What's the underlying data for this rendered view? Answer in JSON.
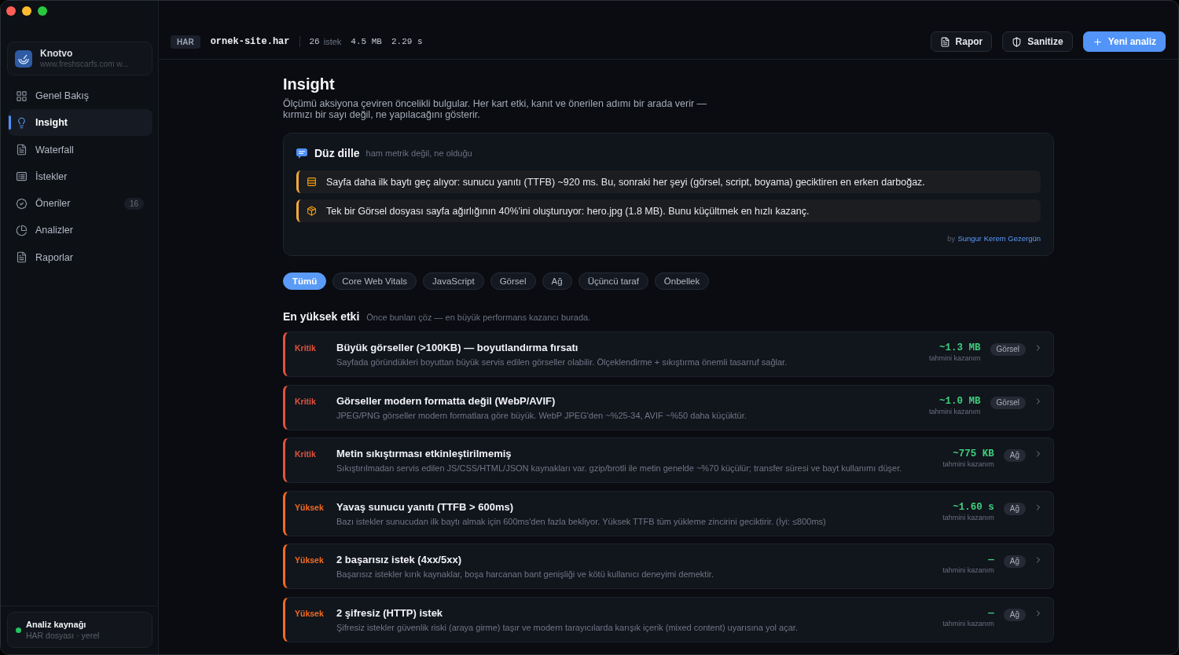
{
  "sidebar": {
    "workspace": {
      "name": "Knotvo",
      "url": "www.freshscarfs.com w..."
    },
    "items": [
      {
        "label": "Genel Bakış",
        "selected": false
      },
      {
        "label": "Insight",
        "selected": true
      },
      {
        "label": "Waterfall",
        "selected": false
      },
      {
        "label": "İstekler",
        "selected": false
      },
      {
        "label": "Öneriler",
        "selected": false,
        "badge": "16"
      },
      {
        "label": "Analizler",
        "selected": false
      },
      {
        "label": "Raporlar",
        "selected": false
      }
    ],
    "source": {
      "title": "Analiz kaynağı",
      "subtitle": "HAR dosyası · yerel",
      "active": true
    }
  },
  "topbar": {
    "format": "HAR",
    "file": "ornek-site.har",
    "request_count": "26",
    "request_label": "istek",
    "size": "4.5 MB",
    "duration": "2.29 s",
    "actions": [
      {
        "label": "Rapor",
        "kind": "secondary"
      },
      {
        "label": "Sanitize",
        "kind": "secondary"
      },
      {
        "label": "Yeni analiz",
        "kind": "primary"
      }
    ]
  },
  "page": {
    "title": "Insight",
    "subtitle": "Ölçümü aksiyona çeviren öncelikli bulgular. Her kart etki, kanıt ve önerilen adımı bir arada verir —\nkırmızı bir sayı değil, ne yapılacağını gösterir."
  },
  "plain_language": {
    "title": "Düz dille",
    "subtitle": "ham metrik değil, ne olduğu",
    "items": [
      "Sayfa daha ilk baytı geç alıyor: sunucu yanıtı (TTFB) ~920 ms. Bu, sonraki her şeyi (görsel, script, boyama) geciktiren en erken darboğaz.",
      "Tek bir Görsel dosyası sayfa ağırlığının 40%'ini oluşturuyor: hero.jpg (1.8 MB). Bunu küçültmek en hızlı kazanç."
    ],
    "credit": {
      "prefix": "by",
      "author": "Sungur Kerem Gezergün"
    }
  },
  "filters": [
    {
      "label": "Tümü",
      "selected": true
    },
    {
      "label": "Core Web Vitals",
      "selected": false
    },
    {
      "label": "JavaScript",
      "selected": false
    },
    {
      "label": "Görsel",
      "selected": false
    },
    {
      "label": "Ağ",
      "selected": false
    },
    {
      "label": "Üçüncü taraf",
      "selected": false
    },
    {
      "label": "Önbellek",
      "selected": false
    }
  ],
  "section": {
    "title": "En yüksek etki",
    "subtitle": "Önce bunları çöz — en büyük performans kazancı burada."
  },
  "findings": [
    {
      "severity": "Kritik",
      "color": "#e5533d",
      "title": "Büyük görseller (>100KB) — boyutlandırma fırsatı",
      "description": "Sayfada göründükleri boyuttan büyük servis edilen görseller olabilir. Ölçeklendirme + sıkıştırma önemli tasarruf sağlar.",
      "gain": "~1.3 MB",
      "gain_label": "tahmini kazanım",
      "tag": "Görsel"
    },
    {
      "severity": "Kritik",
      "color": "#e5533d",
      "title": "Görseller modern formatta değil (WebP/AVIF)",
      "description": "JPEG/PNG görseller modern formatlara göre büyük. WebP JPEG'den ~%25-34, AVIF ~%50 daha küçüktür.",
      "gain": "~1.0 MB",
      "gain_label": "tahmini kazanım",
      "tag": "Görsel"
    },
    {
      "severity": "Kritik",
      "color": "#e5533d",
      "title": "Metin sıkıştırması etkinleştirilmemiş",
      "description": "Sıkıştırılmadan servis edilen JS/CSS/HTML/JSON kaynakları var. gzip/brotli ile metin genelde ~%70 küçülür; transfer süresi ve bayt kullanımı düşer.",
      "gain": "~775 KB",
      "gain_label": "tahmini kazanım",
      "tag": "Ağ"
    },
    {
      "severity": "Yüksek",
      "color": "#f36b22",
      "title": "Yavaş sunucu yanıtı (TTFB > 600ms)",
      "description": "Bazı istekler sunucudan ilk baytı almak için 600ms'den fazla bekliyor. Yüksek TTFB tüm yükleme zincirini geciktirir. (İyi: ≤800ms)",
      "gain": "~1.60 s",
      "gain_label": "tahmini kazanım",
      "tag": "Ağ"
    },
    {
      "severity": "Yüksek",
      "color": "#f36b22",
      "title": "2 başarısız istek (4xx/5xx)",
      "description": "Başarısız istekler kırık kaynaklar, boşa harcanan bant genişliği ve kötü kullanıcı deneyimi demektir.",
      "gain": "—",
      "gain_label": "tahmini kazanım",
      "tag": "Ağ"
    },
    {
      "severity": "Yüksek",
      "color": "#f36b22",
      "title": "2 şifresiz (HTTP) istek",
      "description": "Şifresiz istekler güvenlik riski (araya girme) taşır ve modern tarayıcılarda karışık içerik (mixed content) uyarısına yol açar.",
      "gain": "—",
      "gain_label": "tahmini kazanım",
      "tag": "Ağ"
    }
  ]
}
